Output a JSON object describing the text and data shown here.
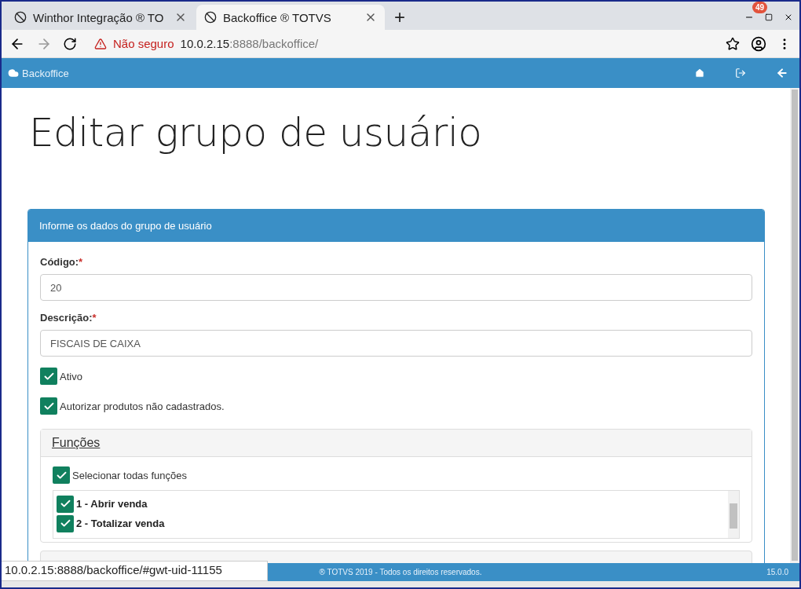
{
  "browser": {
    "tabs": [
      {
        "title": "Winthor Integração ® TO",
        "selected": false
      },
      {
        "title": "Backoffice ® TOTVS",
        "selected": true
      }
    ],
    "new_tab": "+",
    "badge": "49",
    "security": "Não seguro",
    "url_host": "10.0.2.15",
    "url_path": ":8888/backoffice/"
  },
  "navbar": {
    "brand": "Backoffice"
  },
  "page": {
    "title": "Editar grupo de usuário"
  },
  "panel": {
    "header": "Informe os dados do grupo de usuário",
    "fields": [
      {
        "label": "Código:",
        "required": "*",
        "value": "20"
      },
      {
        "label": "Descrição:",
        "required": "*",
        "value": "FISCAIS DE CAIXA"
      }
    ],
    "checkboxes": [
      {
        "label": "Ativo",
        "checked": true
      },
      {
        "label": "Autorizar produtos não cadastrados.",
        "checked": true
      }
    ],
    "functions": {
      "title": "Funções",
      "select_all": {
        "label": "Selecionar todas funções",
        "checked": true
      },
      "items": [
        {
          "label": "1 - Abrir venda",
          "checked": true
        },
        {
          "label": "2 - Totalizar venda",
          "checked": true
        }
      ]
    }
  },
  "footer": {
    "copyright": "® TOTVS 2019 - Todos os direitos reservados.",
    "version": "15.0.0"
  },
  "status_url": "10.0.2.15:8888/backoffice/#gwt-uid-11155"
}
